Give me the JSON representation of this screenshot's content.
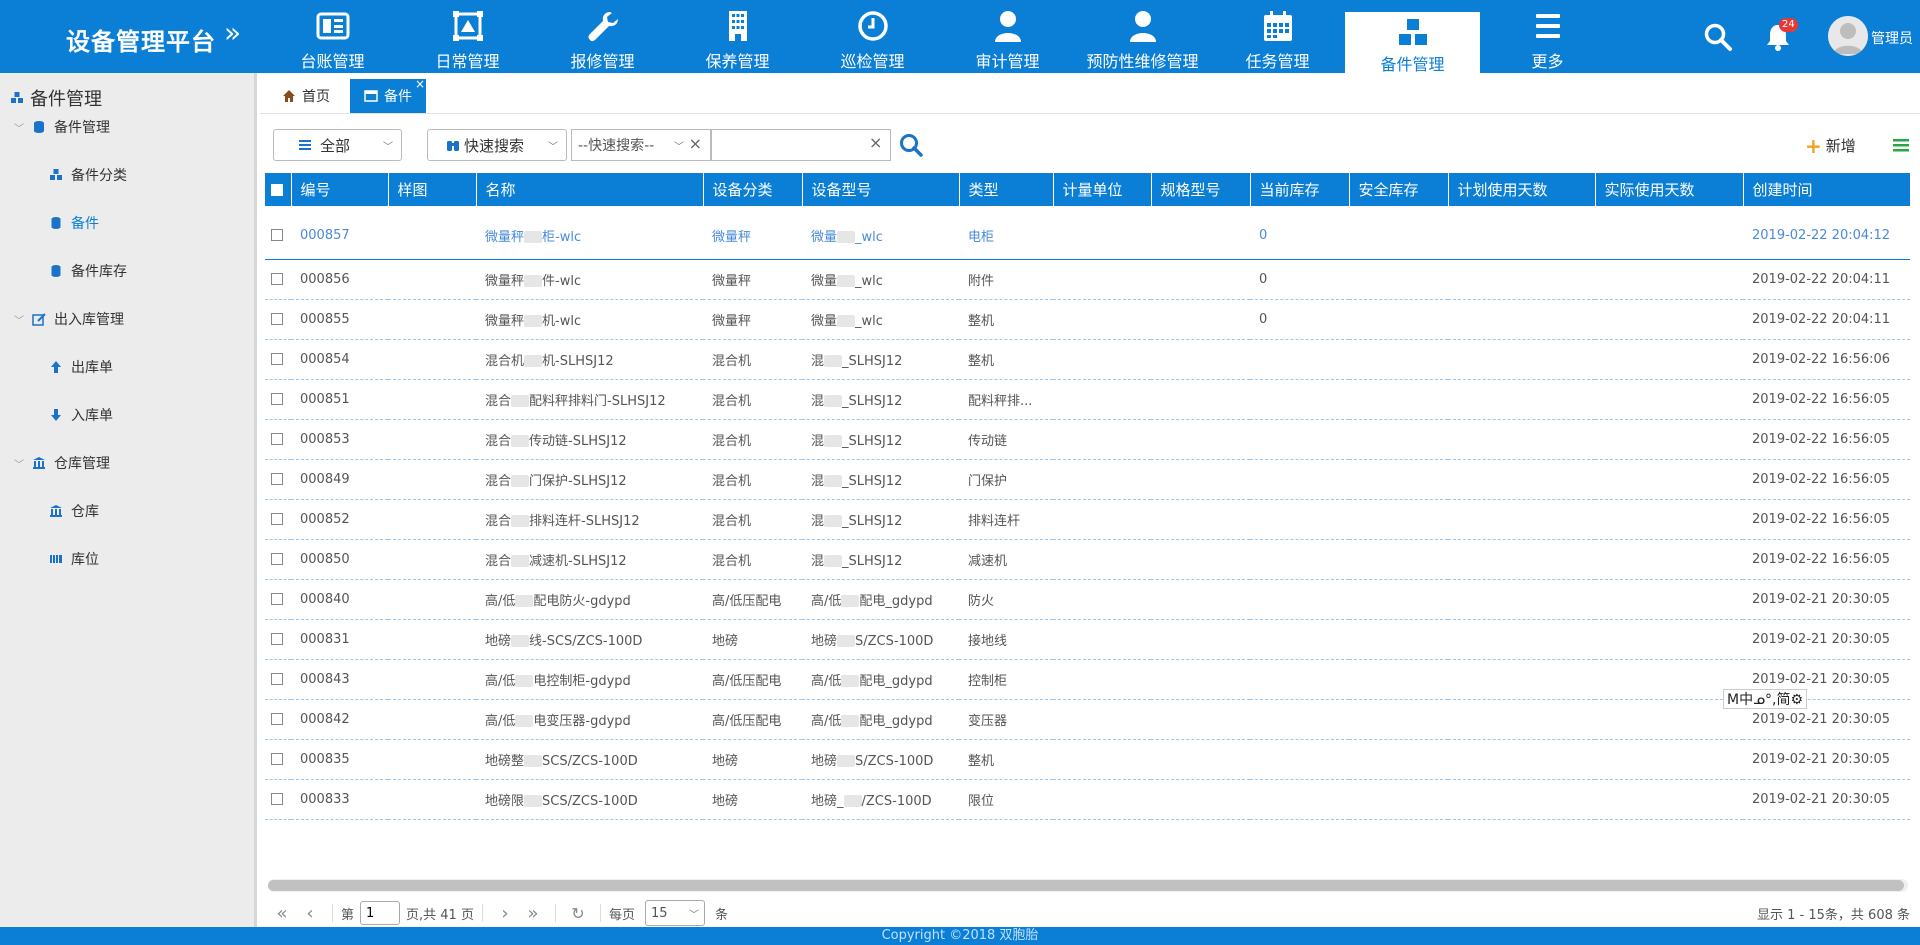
{
  "header": {
    "title": "设备管理平台",
    "toggle": "»",
    "nav": [
      {
        "label": "台账管理",
        "icon": "ledger-icon"
      },
      {
        "label": "日常管理",
        "icon": "frame-icon"
      },
      {
        "label": "报修管理",
        "icon": "wrench-icon"
      },
      {
        "label": "保养管理",
        "icon": "building-icon"
      },
      {
        "label": "巡检管理",
        "icon": "clock-icon"
      },
      {
        "label": "审计管理",
        "icon": "user-icon"
      },
      {
        "label": "预防性维修管理",
        "icon": "user-icon"
      },
      {
        "label": "任务管理",
        "icon": "calendar-icon"
      },
      {
        "label": "备件管理",
        "icon": "cubes-icon",
        "active": true
      },
      {
        "label": "更多",
        "icon": "menu-icon"
      }
    ],
    "notifications": "24",
    "user": "管理员"
  },
  "sidebar": {
    "title": "备件管理",
    "groups": [
      {
        "label": "备件管理",
        "items": [
          "备件分类",
          "备件",
          "备件库存"
        ]
      },
      {
        "label": "出入库管理",
        "items": [
          "出库单",
          "入库单"
        ]
      },
      {
        "label": "仓库管理",
        "items": [
          "仓库",
          "库位"
        ]
      }
    ]
  },
  "tabs": {
    "home": "首页",
    "current": "备件",
    "close": "×"
  },
  "toolbar": {
    "filter": "全部",
    "quick_search": "快速搜索",
    "search_field": "--快速搜索--",
    "search_value": "",
    "add": "新增"
  },
  "table": {
    "columns": [
      "编号",
      "样图",
      "名称",
      "设备分类",
      "设备型号",
      "类型",
      "计量单位",
      "规格型号",
      "当前库存",
      "安全库存",
      "计划使用天数",
      "实际使用天数",
      "创建时间"
    ],
    "rows": [
      {
        "id": "000857",
        "name_a": "微量秤",
        "name_b": "柜-wlc",
        "cat": "微量秤",
        "model_a": "微量",
        "model_b": "_wlc",
        "type": "电柜",
        "stock": "0",
        "created": "2019-02-22 20:04:12"
      },
      {
        "id": "000856",
        "name_a": "微量秤",
        "name_b": "件-wlc",
        "cat": "微量秤",
        "model_a": "微量",
        "model_b": "_wlc",
        "type": "附件",
        "stock": "0",
        "created": "2019-02-22 20:04:11"
      },
      {
        "id": "000855",
        "name_a": "微量秤",
        "name_b": "机-wlc",
        "cat": "微量秤",
        "model_a": "微量",
        "model_b": "_wlc",
        "type": "整机",
        "stock": "0",
        "created": "2019-02-22 20:04:11"
      },
      {
        "id": "000854",
        "name_a": "混合机",
        "name_b": "机-SLHSJ12",
        "cat": "混合机",
        "model_a": "混",
        "model_b": "_SLHSJ12",
        "type": "整机",
        "stock": "",
        "created": "2019-02-22 16:56:06"
      },
      {
        "id": "000851",
        "name_a": "混合",
        "name_b": "配料秤排料门-SLHSJ12",
        "cat": "混合机",
        "model_a": "混",
        "model_b": "_SLHSJ12",
        "type": "配料秤排...",
        "stock": "",
        "created": "2019-02-22 16:56:05"
      },
      {
        "id": "000853",
        "name_a": "混合",
        "name_b": "传动链-SLHSJ12",
        "cat": "混合机",
        "model_a": "混",
        "model_b": "_SLHSJ12",
        "type": "传动链",
        "stock": "",
        "created": "2019-02-22 16:56:05"
      },
      {
        "id": "000849",
        "name_a": "混合",
        "name_b": "门保护-SLHSJ12",
        "cat": "混合机",
        "model_a": "混",
        "model_b": "_SLHSJ12",
        "type": "门保护",
        "stock": "",
        "created": "2019-02-22 16:56:05"
      },
      {
        "id": "000852",
        "name_a": "混合",
        "name_b": "排料连杆-SLHSJ12",
        "cat": "混合机",
        "model_a": "混",
        "model_b": "_SLHSJ12",
        "type": "排料连杆",
        "stock": "",
        "created": "2019-02-22 16:56:05"
      },
      {
        "id": "000850",
        "name_a": "混合",
        "name_b": "减速机-SLHSJ12",
        "cat": "混合机",
        "model_a": "混",
        "model_b": "_SLHSJ12",
        "type": "减速机",
        "stock": "",
        "created": "2019-02-22 16:56:05"
      },
      {
        "id": "000840",
        "name_a": "高/低",
        "name_b": "配电防火-gdypd",
        "cat": "高/低压配电",
        "model_a": "高/低",
        "model_b": "配电_gdypd",
        "type": "防火",
        "stock": "",
        "created": "2019-02-21 20:30:05"
      },
      {
        "id": "000831",
        "name_a": "地磅",
        "name_b": "线-SCS/ZCS-100D",
        "cat": "地磅",
        "model_a": "地磅",
        "model_b": "S/ZCS-100D",
        "type": "接地线",
        "stock": "",
        "created": "2019-02-21 20:30:05"
      },
      {
        "id": "000843",
        "name_a": "高/低",
        "name_b": "电控制柜-gdypd",
        "cat": "高/低压配电",
        "model_a": "高/低",
        "model_b": "配电_gdypd",
        "type": "控制柜",
        "stock": "",
        "created": "2019-02-21 20:30:05"
      },
      {
        "id": "000842",
        "name_a": "高/低",
        "name_b": "电变压器-gdypd",
        "cat": "高/低压配电",
        "model_a": "高/低",
        "model_b": "配电_gdypd",
        "type": "变压器",
        "stock": "",
        "created": "2019-02-21 20:30:05"
      },
      {
        "id": "000835",
        "name_a": "地磅整",
        "name_b": "SCS/ZCS-100D",
        "cat": "地磅",
        "model_a": "地磅",
        "model_b": "S/ZCS-100D",
        "type": "整机",
        "stock": "",
        "created": "2019-02-21 20:30:05"
      },
      {
        "id": "000833",
        "name_a": "地磅限",
        "name_b": "SCS/ZCS-100D",
        "cat": "地磅",
        "model_a": "地磅_",
        "model_b": "/ZCS-100D",
        "type": "限位",
        "stock": "",
        "created": "2019-02-21 20:30:05"
      }
    ]
  },
  "pager": {
    "page_prefix": "第",
    "page": "1",
    "page_suffix": "页,共 41 页",
    "per_page_label": "每页",
    "per_page": "15",
    "per_page_unit": "条",
    "info": "显示 1 - 15条，共 608 条"
  },
  "footer": "Copyright ©2018 双胞胎",
  "ime": "M中ᓄ°,简⚙"
}
